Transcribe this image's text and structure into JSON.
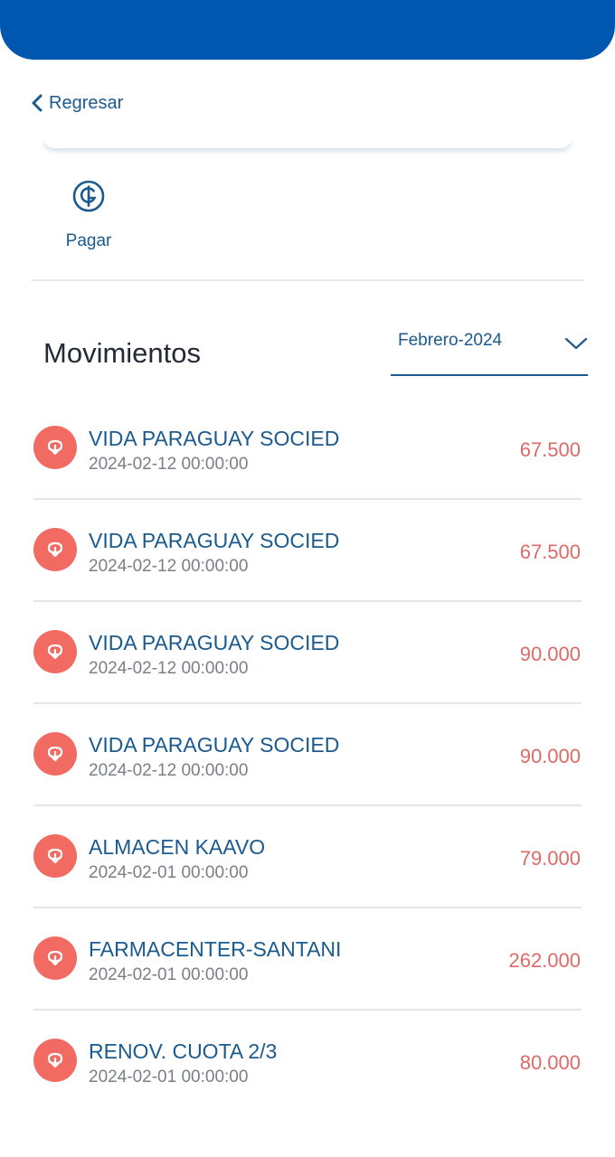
{
  "header": {
    "back_label": "Regresar"
  },
  "actions": {
    "pay_label": "Pagar",
    "pay_icon": "guarani-coin-icon"
  },
  "movements": {
    "title": "Movimientos",
    "month_selected": "Febrero-2024",
    "items": [
      {
        "name": "VIDA PARAGUAY SOCIED",
        "date": "2024-02-12 00:00:00",
        "amount": "67.500"
      },
      {
        "name": "VIDA PARAGUAY SOCIED",
        "date": "2024-02-12 00:00:00",
        "amount": "67.500"
      },
      {
        "name": "VIDA PARAGUAY SOCIED",
        "date": "2024-02-12 00:00:00",
        "amount": "90.000"
      },
      {
        "name": "VIDA PARAGUAY SOCIED",
        "date": "2024-02-12 00:00:00",
        "amount": "90.000"
      },
      {
        "name": "ALMACEN KAAVO",
        "date": "2024-02-01 00:00:00",
        "amount": "79.000"
      },
      {
        "name": "FARMACENTER-SANTANI",
        "date": "2024-02-01 00:00:00",
        "amount": "262.000"
      },
      {
        "name": "RENOV. CUOTA 2/3",
        "date": "2024-02-01 00:00:00",
        "amount": "80.000"
      }
    ]
  },
  "colors": {
    "brand_blue": "#0057b0",
    "text_blue": "#1b5a8f",
    "debit_red": "#de6a66",
    "icon_red": "#f26b62"
  }
}
